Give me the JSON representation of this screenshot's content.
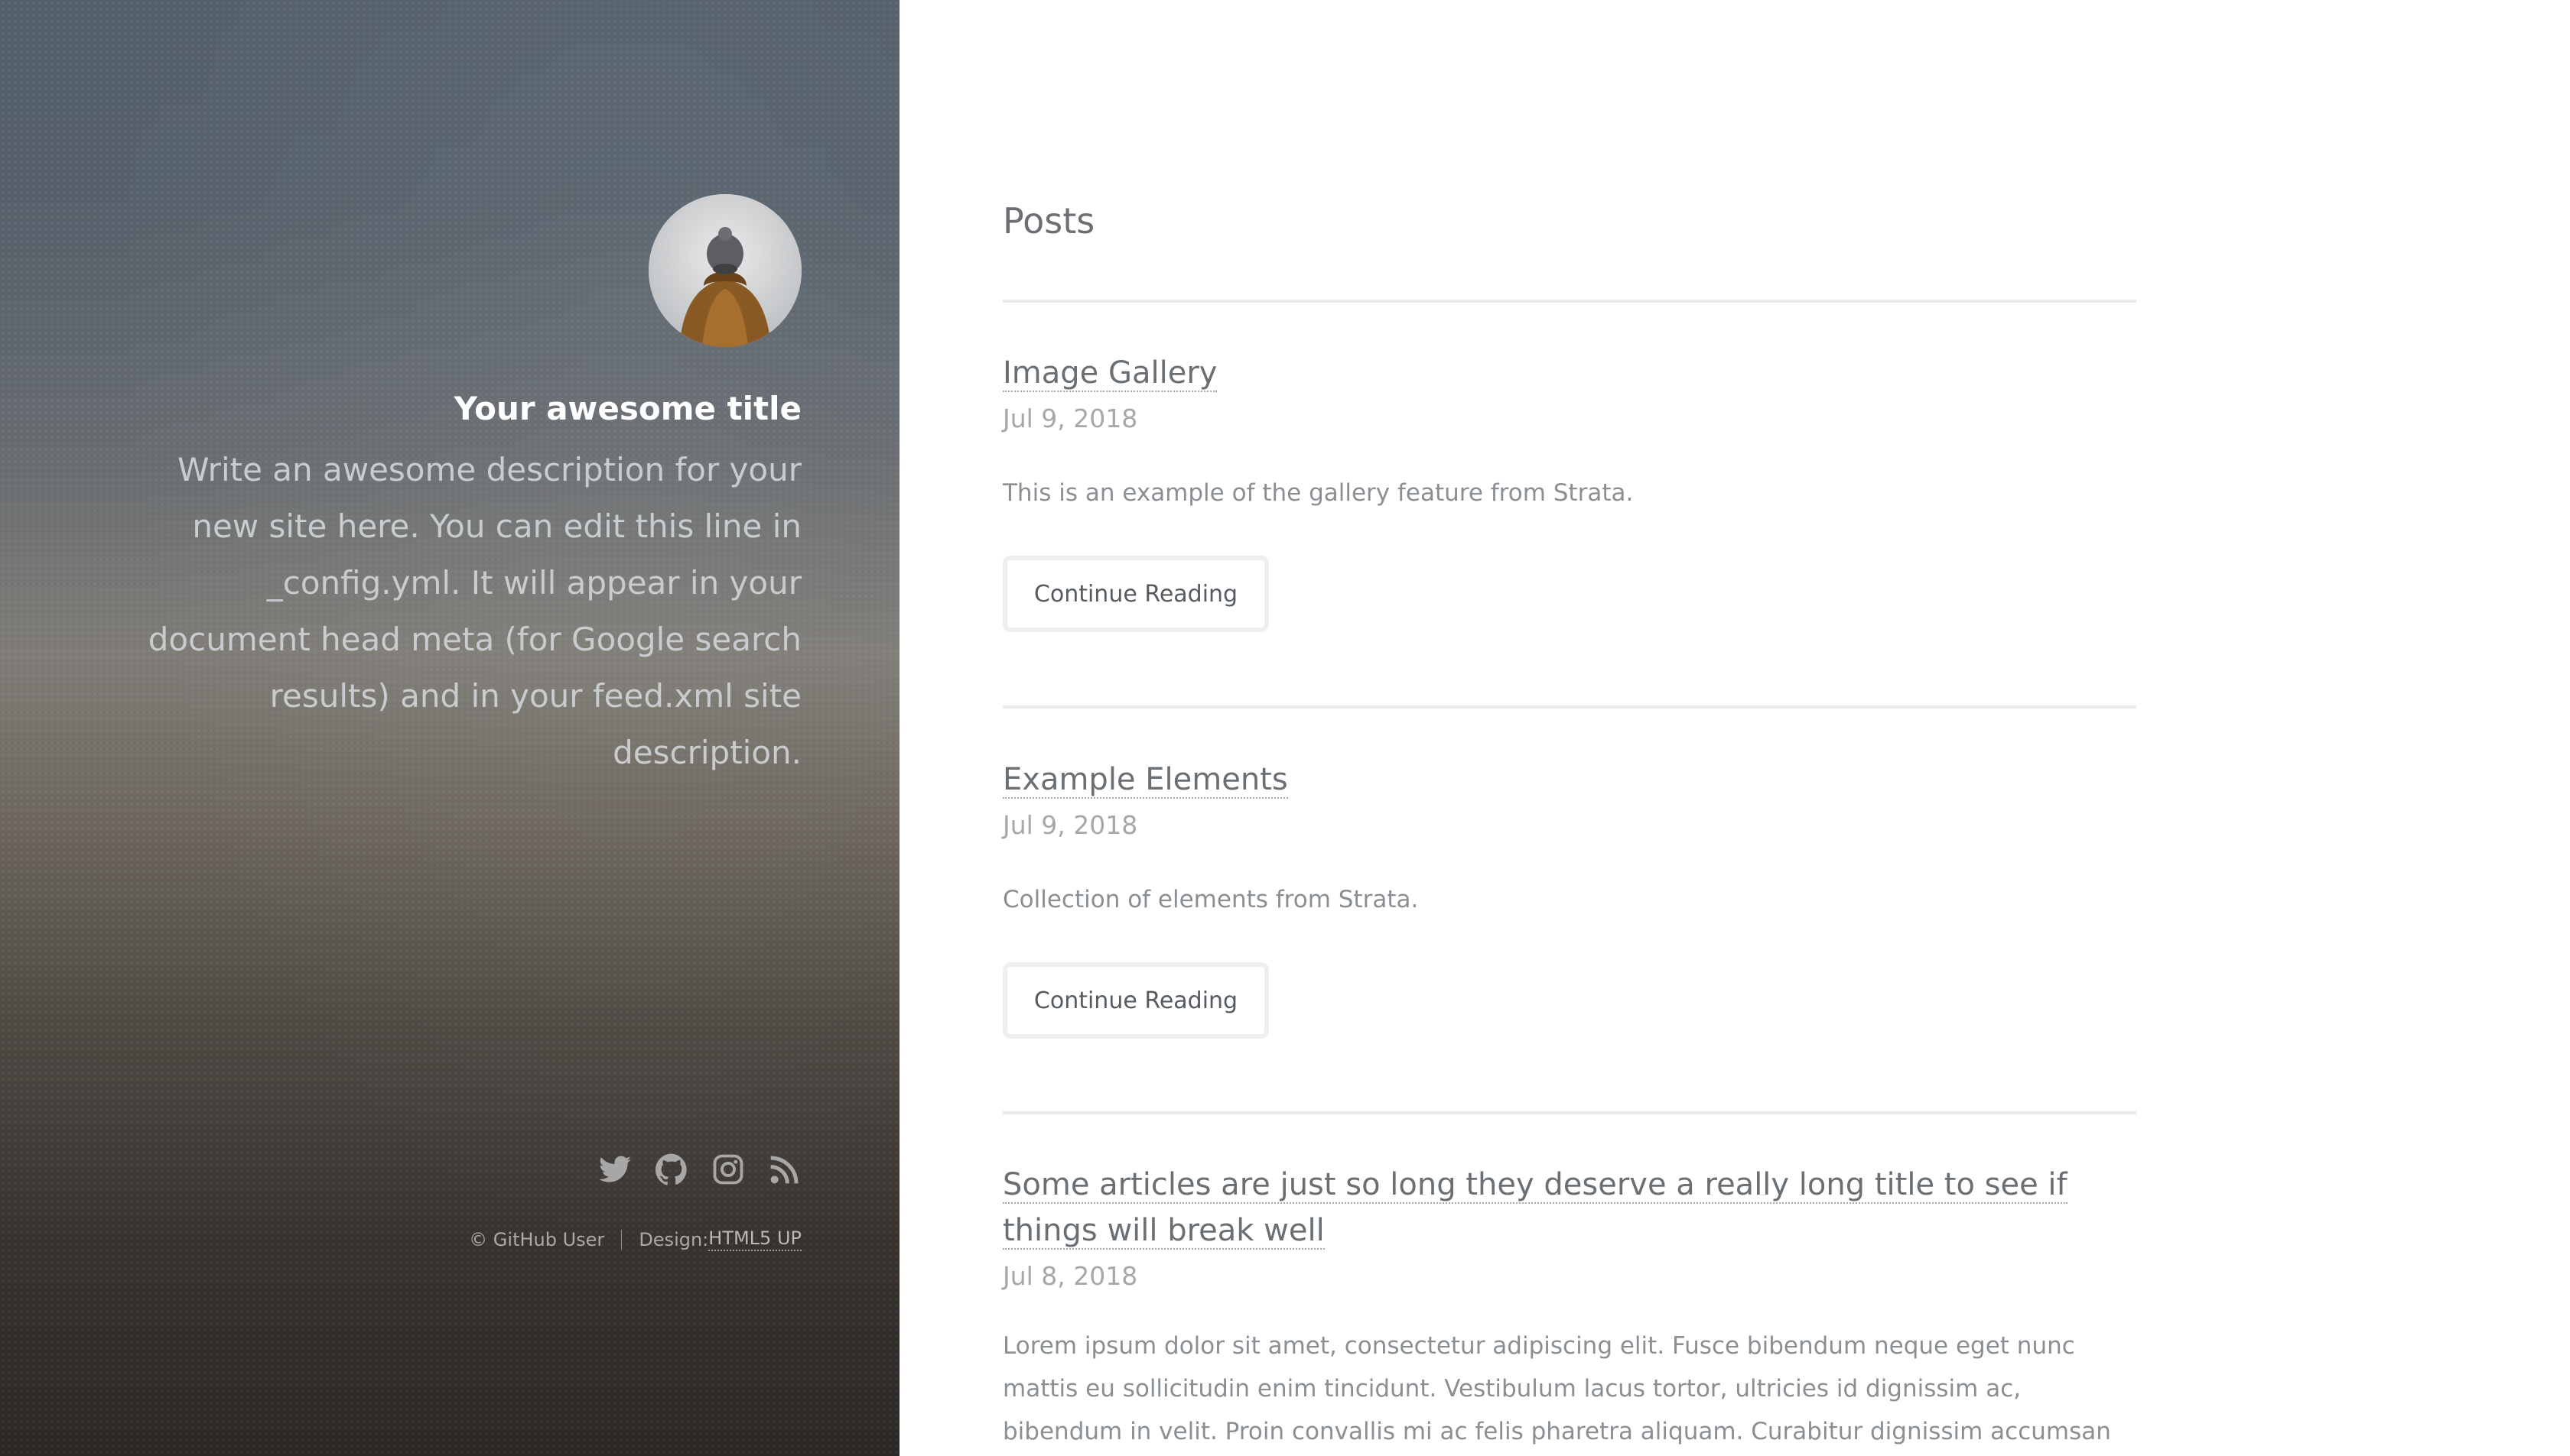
{
  "sidebar": {
    "avatar_alt": "avatar",
    "title": "Your awesome title",
    "description": "Write an awesome description for your new site here. You can edit this line in _config.yml. It will appear in your document head meta (for Google search results) and in your feed.xml site description.",
    "social_icons": [
      "twitter-icon",
      "github-icon",
      "instagram-icon",
      "rss-icon"
    ],
    "footer": {
      "copyright": "© GitHub User",
      "design_label": "Design: ",
      "design_link": "HTML5 UP"
    }
  },
  "main": {
    "heading": "Posts",
    "posts": [
      {
        "title": "Image Gallery",
        "date": "Jul 9, 2018",
        "excerpt": "This is an example of the gallery feature from Strata.",
        "button": "Continue Reading"
      },
      {
        "title": "Example Elements",
        "date": "Jul 9, 2018",
        "excerpt": "Collection of elements from Strata.",
        "button": "Continue Reading"
      },
      {
        "title": "Some articles are just so long they deserve a really long title to see if things will break well",
        "date": "Jul 8, 2018",
        "excerpt": "Lorem ipsum dolor sit amet, consectetur adipiscing elit. Fusce bibendum neque eget nunc mattis eu sollicitudin enim tincidunt. Vestibulum lacus tortor, ultricies id dignissim ac, bibendum in velit. Proin convallis mi ac felis pharetra aliquam. Curabitur dignissim accumsan rutrum. In arcu magna, aliquet vel pretium et,"
      }
    ]
  },
  "colors": {
    "sidebar_top": "#535f6b",
    "sidebar_bottom": "#2c2825",
    "title_white": "#ffffff",
    "body_text": "#8a8f94",
    "rule": "#eaeaea"
  }
}
